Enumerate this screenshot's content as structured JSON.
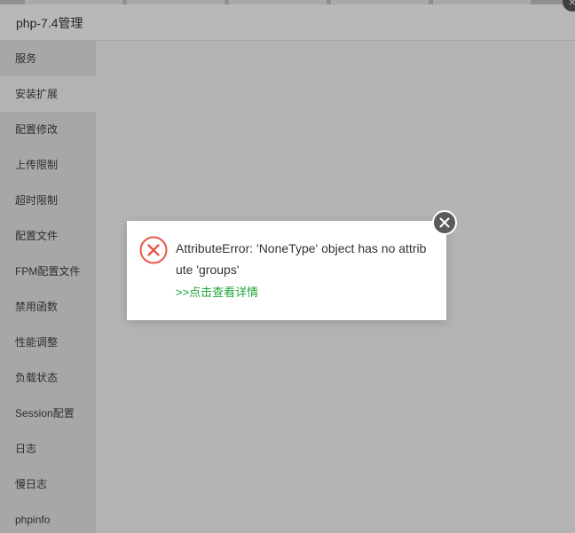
{
  "window": {
    "title": "php-7.4管理",
    "close_glyph": "×"
  },
  "sidebar": {
    "items": [
      {
        "label": "服务"
      },
      {
        "label": "安装扩展"
      },
      {
        "label": "配置修改"
      },
      {
        "label": "上传限制"
      },
      {
        "label": "超时限制"
      },
      {
        "label": "配置文件"
      },
      {
        "label": "FPM配置文件"
      },
      {
        "label": "禁用函数"
      },
      {
        "label": "性能调整"
      },
      {
        "label": "负载状态"
      },
      {
        "label": "Session配置"
      },
      {
        "label": "日志"
      },
      {
        "label": "慢日志"
      },
      {
        "label": "phpinfo"
      }
    ],
    "active_index": 1
  },
  "dialog": {
    "icon": "error-circle-icon",
    "message": "AttributeError: 'NoneType' object has no attribute 'groups'",
    "link": ">>点击查看详情",
    "close_icon": "close-icon"
  },
  "colors": {
    "error": "#e8574a",
    "link": "#20a53a",
    "overlay": "#b3b3b3"
  }
}
